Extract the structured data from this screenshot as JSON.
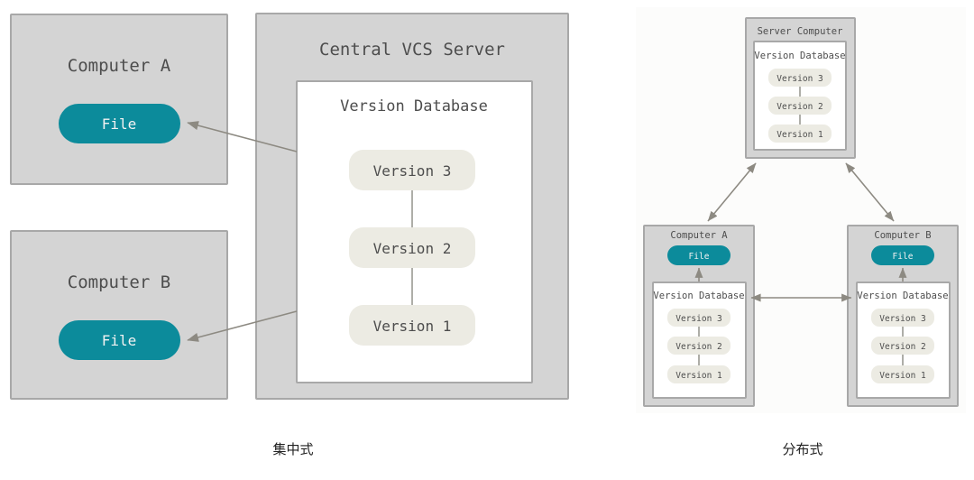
{
  "meta": {
    "accent_color": "#0c8b9b",
    "box_fill": "#d4d4d4",
    "box_stroke": "#a8a8a8",
    "pill_fill": "#ecebe3",
    "panel_bg": "#fcfcfb",
    "text_color": "#4d4d4d"
  },
  "captions": {
    "left": "集中式",
    "right": "分布式"
  },
  "centralized": {
    "computer_a": {
      "title": "Computer A",
      "file_label": "File"
    },
    "computer_b": {
      "title": "Computer B",
      "file_label": "File"
    },
    "server": {
      "title": "Central VCS Server",
      "database_title": "Version Database",
      "versions": [
        "Version 3",
        "Version 2",
        "Version 1"
      ]
    }
  },
  "distributed": {
    "server": {
      "title": "Server Computer",
      "database_title": "Version Database",
      "versions": [
        "Version 3",
        "Version 2",
        "Version 1"
      ]
    },
    "computer_a": {
      "title": "Computer A",
      "file_label": "File",
      "database_title": "Version Database",
      "versions": [
        "Version 3",
        "Version 2",
        "Version 1"
      ]
    },
    "computer_b": {
      "title": "Computer B",
      "file_label": "File",
      "database_title": "Version Database",
      "versions": [
        "Version 3",
        "Version 2",
        "Version 1"
      ]
    }
  }
}
